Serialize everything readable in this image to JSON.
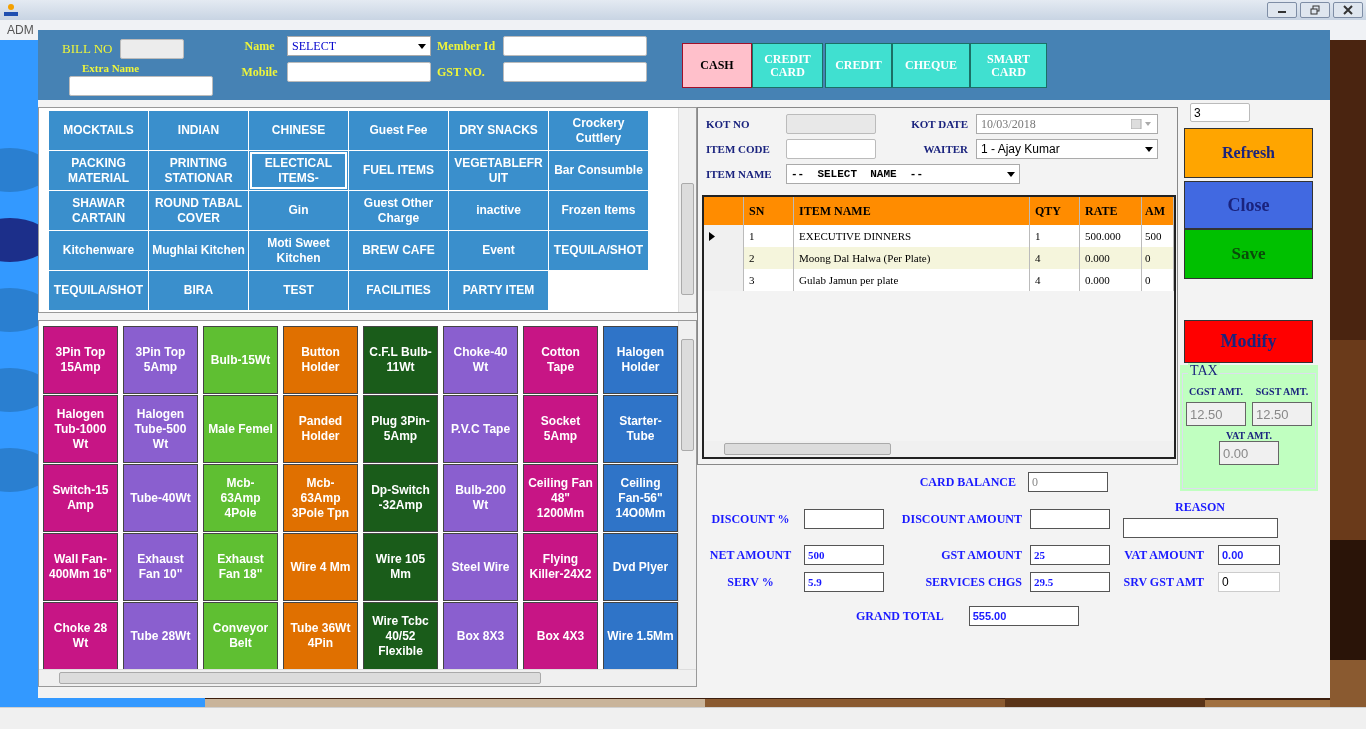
{
  "menu": [
    {
      "label": "ADM"
    }
  ],
  "header": {
    "bill_no": {
      "label": "BILL NO"
    },
    "extra_name": {
      "label": "Extra Name"
    },
    "name": {
      "label": "Name",
      "value": "SELECT"
    },
    "mobile": {
      "label": "Mobile"
    },
    "member_id": {
      "label": "Member Id"
    },
    "gst_no": {
      "label": "GST NO."
    }
  },
  "payment_modes": [
    {
      "label": "CASH",
      "selected": true
    },
    {
      "label": "CREDIT CARD",
      "selected": false
    },
    {
      "label": "CREDIT",
      "selected": false
    },
    {
      "label": "CHEQUE",
      "selected": false
    },
    {
      "label": "SMART CARD",
      "selected": false
    }
  ],
  "categories": [
    {
      "label": "MOCKTAILS",
      "selected": false
    },
    {
      "label": "INDIAN",
      "selected": false
    },
    {
      "label": "CHINESE",
      "selected": false
    },
    {
      "label": "Guest Fee",
      "selected": false
    },
    {
      "label": "DRY SNACKS",
      "selected": false
    },
    {
      "label": "Crockery Cuttlery",
      "selected": false
    },
    {
      "label": "PACKING MATERIAL",
      "selected": false
    },
    {
      "label": "PRINTING STATIONAR",
      "selected": false
    },
    {
      "label": "ELECTICAL ITEMS-",
      "selected": true
    },
    {
      "label": "FUEL ITEMS",
      "selected": false
    },
    {
      "label": "VEGETABLEFRUIT",
      "selected": false
    },
    {
      "label": "Bar Consumble",
      "selected": false
    },
    {
      "label": "SHAWAR CARTAIN",
      "selected": false
    },
    {
      "label": "ROUND TABAL COVER",
      "selected": false
    },
    {
      "label": "Gin",
      "selected": false
    },
    {
      "label": "Guest Other Charge",
      "selected": false
    },
    {
      "label": "inactive",
      "selected": false
    },
    {
      "label": "Frozen Items",
      "selected": false
    },
    {
      "label": "Kitchenware",
      "selected": false
    },
    {
      "label": "Mughlai Kitchen",
      "selected": false
    },
    {
      "label": "Moti Sweet Kitchen",
      "selected": false
    },
    {
      "label": "BREW CAFE",
      "selected": false
    },
    {
      "label": "Event",
      "selected": false
    },
    {
      "label": "TEQUILA/SHOT",
      "selected": false
    },
    {
      "label": "TEQUILA/SHOT",
      "selected": false
    },
    {
      "label": "BIRA",
      "selected": false
    },
    {
      "label": "TEST",
      "selected": false
    },
    {
      "label": "FACILITIES",
      "selected": false
    },
    {
      "label": "PARTY ITEM",
      "selected": false
    }
  ],
  "item_columns": [
    {
      "color": "#c71585",
      "items": [
        "3Pin Top 15Amp",
        "Halogen Tub-1000 Wt",
        "Switch-15 Amp",
        "Wall Fan-400Mm 16\"",
        "Choke 28 Wt"
      ]
    },
    {
      "color": "#8a5fcf",
      "items": [
        "3Pin Top 5Amp",
        "Halogen Tube-500 Wt",
        "Tube-40Wt",
        "Exhaust Fan 10\"",
        "Tube 28Wt"
      ]
    },
    {
      "color": "#5fbf32",
      "items": [
        "Bulb-15Wt",
        "Male Femel",
        "Mcb-63Amp 4Pole",
        "Exhaust Fan 18\"",
        "Conveyor Belt"
      ]
    },
    {
      "color": "#e07000",
      "items": [
        "Button Holder",
        "Panded Holder",
        "Mcb-63Amp 3Pole Tpn",
        "Wire 4 Mm",
        "Tube 36Wt 4Pin"
      ]
    },
    {
      "color": "#1a5c1a",
      "items": [
        "C.F.L Bulb-11Wt",
        "Plug 3Pin-5Amp",
        "Dp-Switch -32Amp",
        "Wire 105 Mm",
        "Wire Tcbc 40/52 Flexible"
      ]
    },
    {
      "color": "#8a5fcf",
      "items": [
        "Choke-40 Wt",
        "P.V.C Tape",
        "Bulb-200 Wt",
        "Steel Wire",
        "Box 8X3"
      ]
    },
    {
      "color": "#c71585",
      "items": [
        "Cotton Tape",
        "Socket 5Amp",
        "Ceiling Fan 48\" 1200Mm",
        "Flying Killer-24X2",
        "Box 4X3"
      ]
    },
    {
      "color": "#2f74c8",
      "items": [
        "Halogen Holder",
        "Starter-Tube",
        "Ceiling Fan-56\" 14O0Mm",
        "Dvd Plyer",
        "Wire 1.5Mm"
      ]
    }
  ],
  "kot": {
    "kot_no": {
      "label": "KOT NO"
    },
    "kot_date": {
      "label": "KOT DATE",
      "value": "10/03/2018"
    },
    "item_code": {
      "label": "ITEM CODE"
    },
    "waiter": {
      "label": "WAITER",
      "value": "1 - Ajay Kumar"
    },
    "item_name": {
      "label": "ITEM NAME",
      "value": "--  SELECT  NAME  --"
    }
  },
  "order_table": {
    "columns": [
      "SN",
      "ITEM NAME",
      "QTY",
      "RATE",
      "AM"
    ],
    "rows": [
      {
        "current": true,
        "cells": [
          "1",
          "EXECUTIVE DINNERS",
          "1",
          "500.000",
          "500"
        ]
      },
      {
        "current": false,
        "cells": [
          "2",
          "Moong Dal Halwa (Per Plate)",
          "4",
          "0.000",
          "0"
        ]
      },
      {
        "current": false,
        "cells": [
          "3",
          "Gulab Jamun per plate",
          "4",
          "0.000",
          "0"
        ]
      }
    ]
  },
  "counter": {
    "value": "3"
  },
  "actions": [
    {
      "label": "Refresh",
      "kind": "refresh"
    },
    {
      "label": "Close",
      "kind": "close"
    },
    {
      "label": "Save",
      "kind": "save"
    },
    {
      "label": "Modify",
      "kind": "modify"
    }
  ],
  "tax": {
    "title": "TAX",
    "cgst": {
      "label": "CGST AMT.",
      "value": "12.50"
    },
    "sgst": {
      "label": "SGST AMT.",
      "value": "12.50"
    },
    "vat": {
      "label": "VAT AMT.",
      "value": "0.00"
    }
  },
  "totals": {
    "card_balance": {
      "label": "CARD BALANCE",
      "value": "0"
    },
    "discount_percent": {
      "label": "DISCOUNT %"
    },
    "discount_amount": {
      "label": "DISCOUNT AMOUNT"
    },
    "reason": {
      "label": "REASON"
    },
    "net_amount": {
      "label": "NET AMOUNT",
      "value": "500"
    },
    "gst_amount": {
      "label": "GST AMOUNT",
      "value": "25"
    },
    "vat_amount": {
      "label": "VAT AMOUNT",
      "value": "0.00"
    },
    "serv_percent": {
      "label": "SERV %",
      "value": "5.9"
    },
    "services_chgs": {
      "label": "SERVICES CHGS",
      "value": "29.5"
    },
    "srv_gst_amt": {
      "label": "SRV GST AMT",
      "value": "0"
    },
    "grand_total": {
      "label": "GRAND TOTAL",
      "value": "555.00"
    }
  }
}
